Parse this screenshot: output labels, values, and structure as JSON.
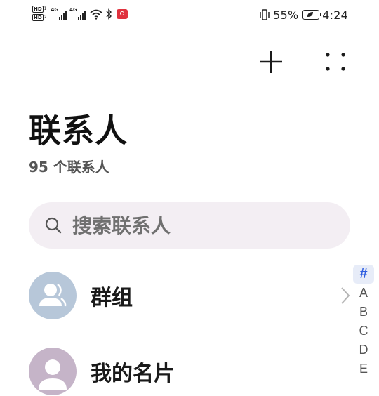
{
  "status_bar": {
    "hd1": "HD",
    "hd1_sub": "1",
    "hd2": "HD",
    "hd2_sub": "2",
    "sig1_tech": "4G",
    "sig2_tech": "4G",
    "battery_percent": "55%",
    "time": "4:24"
  },
  "header": {
    "title": "联系人",
    "subtitle": "95 个联系人"
  },
  "search": {
    "placeholder": "搜索联系人"
  },
  "list": {
    "items": [
      {
        "label": "群组"
      },
      {
        "label": "我的名片"
      }
    ]
  },
  "alpha_index": {
    "letters": [
      "#",
      "A",
      "B",
      "C",
      "D",
      "E"
    ],
    "active": "#"
  },
  "icons": {
    "add": "plus-icon",
    "more": "more-dots-icon",
    "search": "search-icon",
    "chevron": "chevron-right-icon"
  },
  "colors": {
    "accent": "#2d5ce0",
    "search_bg": "#f3eef3",
    "group_avatar_bg": "#b7c7d9",
    "card_avatar_bg": "#c5b4c8"
  }
}
